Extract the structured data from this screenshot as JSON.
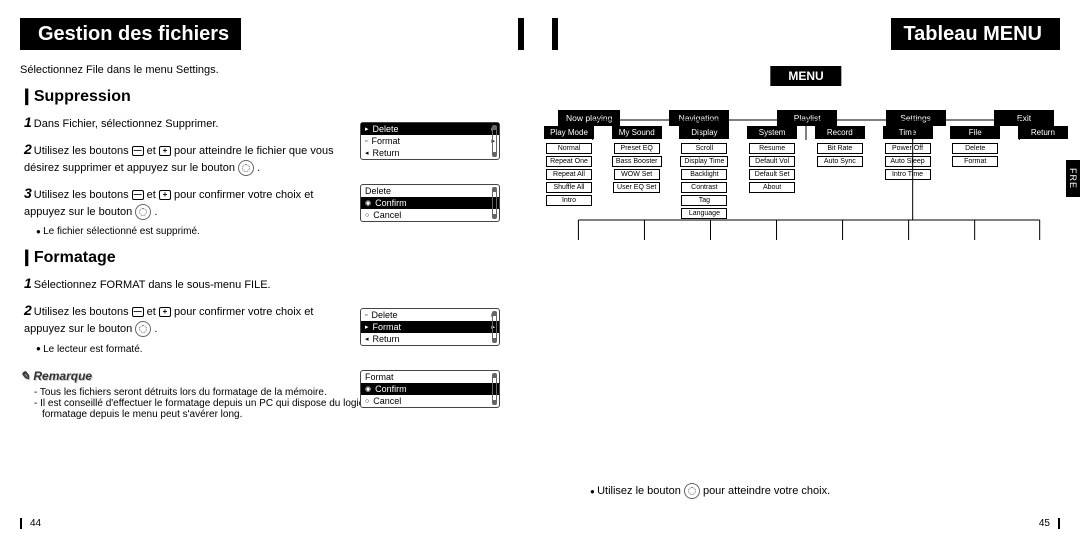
{
  "left": {
    "title": "Gestion des fichiers",
    "intro": "Sélectionnez File dans le menu Settings.",
    "suppression": {
      "heading": "Suppression",
      "step1": "Dans Fichier, sélectionnez Supprimer.",
      "step2a": "Utilisez les boutons ",
      "step2b": " et ",
      "step2c": " pour atteindre le fichier que vous désirez supprimer et appuyez sur le bouton ",
      "step2d": " .",
      "step3a": "Utilisez les boutons ",
      "step3b": " et ",
      "step3c": " pour confirmer votre choix et appuyez sur le bouton ",
      "step3d": " .",
      "result": "Le fichier sélectionné est supprimé.",
      "mini1": {
        "r1": "Delete",
        "r2": "Format",
        "r3": "Return"
      },
      "mini2": {
        "title": "Delete",
        "r1": "Confirm",
        "r2": "Cancel"
      }
    },
    "formatage": {
      "heading": "Formatage",
      "step1": "Sélectionnez FORMAT dans le sous-menu FILE.",
      "step2a": "Utilisez les boutons ",
      "step2b": " et ",
      "step2c": " pour confirmer votre choix et appuyez sur le bouton ",
      "step2d": " .",
      "result": "Le lecteur est formaté.",
      "mini1": {
        "r1": "Delete",
        "r2": "Format",
        "r3": "Return"
      },
      "mini2": {
        "title": "Format",
        "r1": "Confirm",
        "r2": "Cancel"
      }
    },
    "remark": {
      "label": "Remarque",
      "n1": "- Tous les fichiers seront détruits lors du formatage de la mémoire.",
      "n2": "- Il est conseillé d'effectuer le formatage depuis un PC qui dispose du logiciel fourni avec l'appareil, car le formatage depuis le menu peut s'avérer long."
    },
    "page": "44"
  },
  "right": {
    "title": "Tableau MENU",
    "root": "MENU",
    "main": [
      "Now playing",
      "Navigation",
      "Playlist",
      "Settings",
      "Exit"
    ],
    "cats": [
      "Play Mode",
      "My Sound",
      "Display",
      "System",
      "Record",
      "Time",
      "File",
      "Return"
    ],
    "cols": [
      [
        "Normal",
        "Repeat One",
        "Repeat All",
        "Shuffle All",
        "Intro"
      ],
      [
        "Preset EQ",
        "Bass Booster",
        "WOW Set",
        "User EQ Set"
      ],
      [
        "Scroll",
        "Display Time",
        "Backlight",
        "Contrast",
        "Tag",
        "Language"
      ],
      [
        "Resume",
        "Default Vol",
        "Default Set",
        "About"
      ],
      [
        "Bit Rate",
        "Auto Sync"
      ],
      [
        "Power Off",
        "Auto Sleep",
        "Intro Time"
      ],
      [
        "Delete",
        "Format"
      ],
      []
    ],
    "bottom": {
      "a": "Utilisez le bouton ",
      "b": " pour atteindre votre choix."
    },
    "fre": "FRE",
    "page": "45"
  },
  "icons": {
    "minus": "—",
    "plus": "+"
  }
}
